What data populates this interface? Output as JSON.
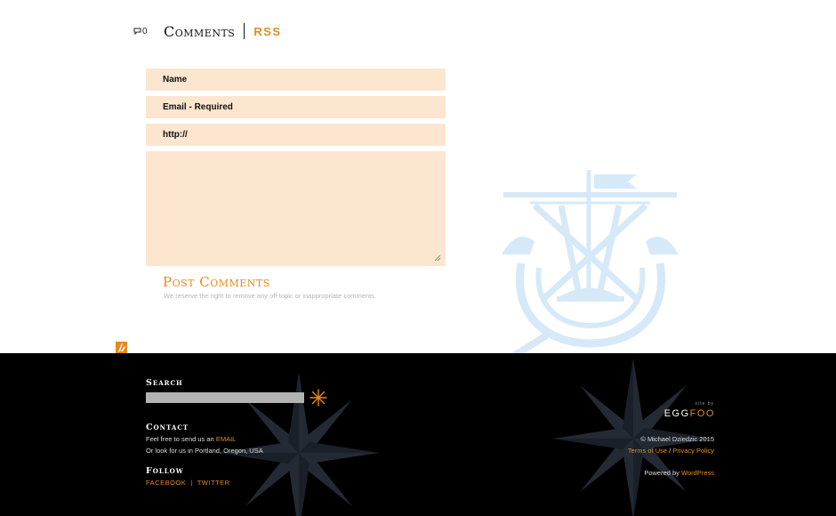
{
  "comments": {
    "count": "0",
    "title": "Comments",
    "rss_label": "RSS"
  },
  "form": {
    "name_placeholder": "Name",
    "email_placeholder": "Email - Required",
    "url_placeholder": "http://",
    "submit_label": "Post Comments",
    "note": "We reserve the right to remove any off-topic or inappropriate comments."
  },
  "footer": {
    "search_heading": "Search",
    "contact_heading": "Contact",
    "contact_line1_prefix": "Feel free to send us an ",
    "contact_email_link": "EMAIL",
    "contact_line2": "Or look for us in Portland, Oregon, USA",
    "follow_heading": "Follow",
    "facebook_label": "FACEBOOK",
    "separator": "|",
    "twitter_label": "TWITTER",
    "site_by_label": "site by",
    "brand_egg": "EGG",
    "brand_foo": "FOO",
    "copyright": "© Michael Dziedzic 2015",
    "terms_label": "Terms of Use",
    "slash": " / ",
    "privacy_label": "Privacy Policy",
    "powered_prefix": "Powered by ",
    "wordpress_label": "WordPress"
  },
  "colors": {
    "accent": "#e68a1c",
    "field_bg": "#fce6cf",
    "footer_bg": "#000000",
    "watermark": "#d6e9f8"
  },
  "icons": [
    "speech-bubble-icon",
    "resize-grip-icon",
    "compass-star-icon",
    "ship-watermark"
  ]
}
